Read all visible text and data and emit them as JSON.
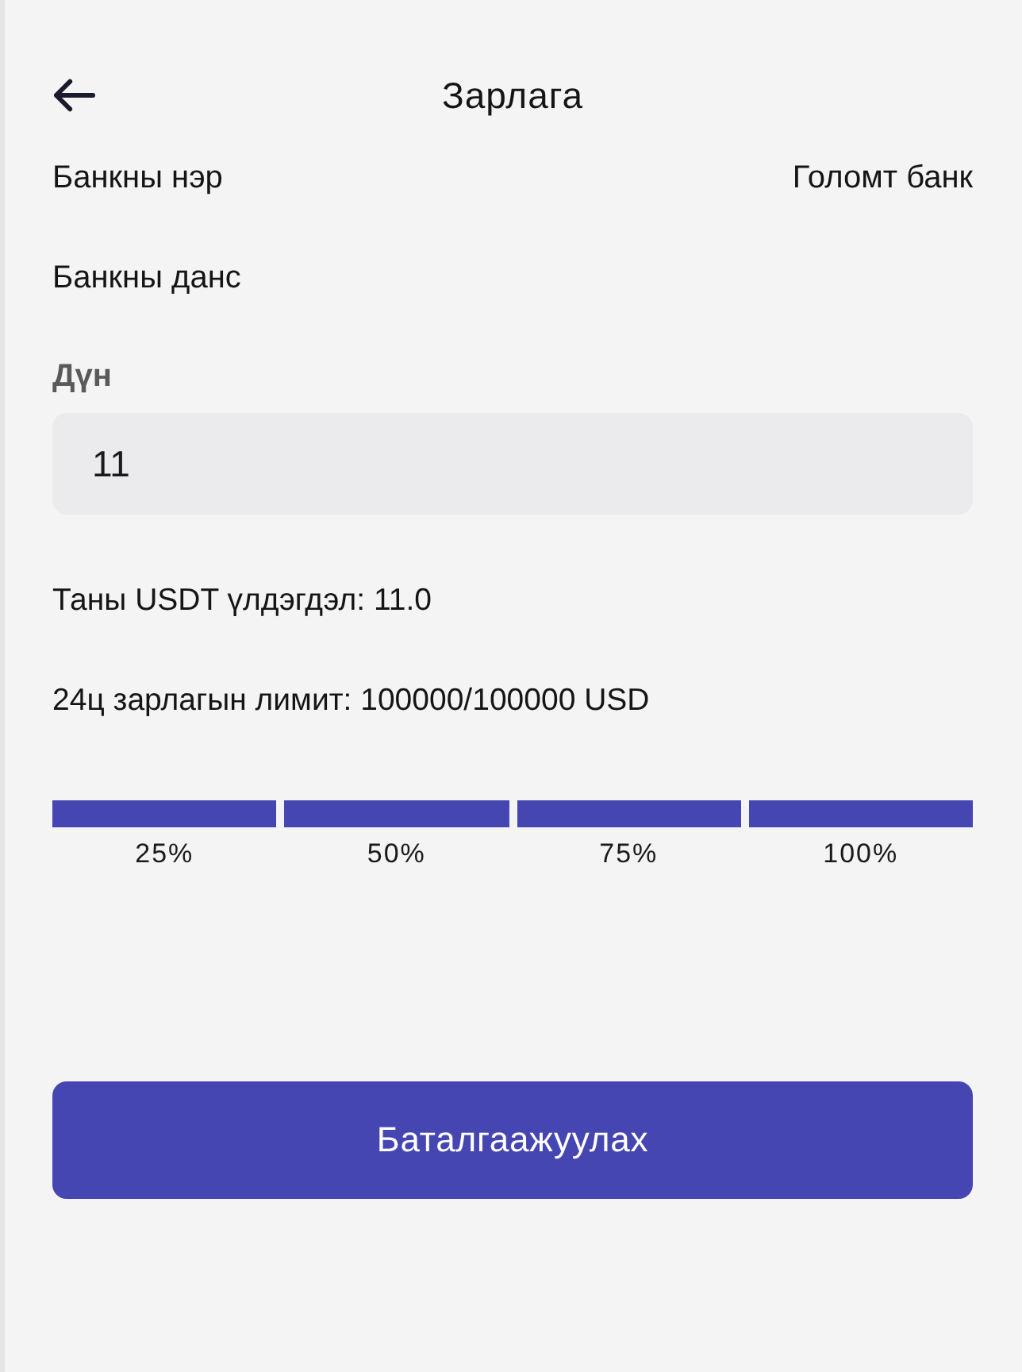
{
  "header": {
    "title": "Зарлага"
  },
  "details": [
    {
      "label": "Банкны нэр",
      "value": "Голомт банк"
    },
    {
      "label": "Банкны данс"
    }
  ],
  "amount": {
    "label": "Дүн",
    "value": "11"
  },
  "info": [
    "Таны USDT үлдэгдэл: 11.0",
    "24ц зарлагын лимит: 100000/100000 USD"
  ],
  "presets": [
    {
      "label": "25%",
      "active": true
    },
    {
      "label": "50%",
      "active": true
    },
    {
      "label": "75%",
      "active": true
    },
    {
      "label": "100%",
      "active": true
    }
  ],
  "submit": {
    "label": "Баталгаажуулах"
  }
}
